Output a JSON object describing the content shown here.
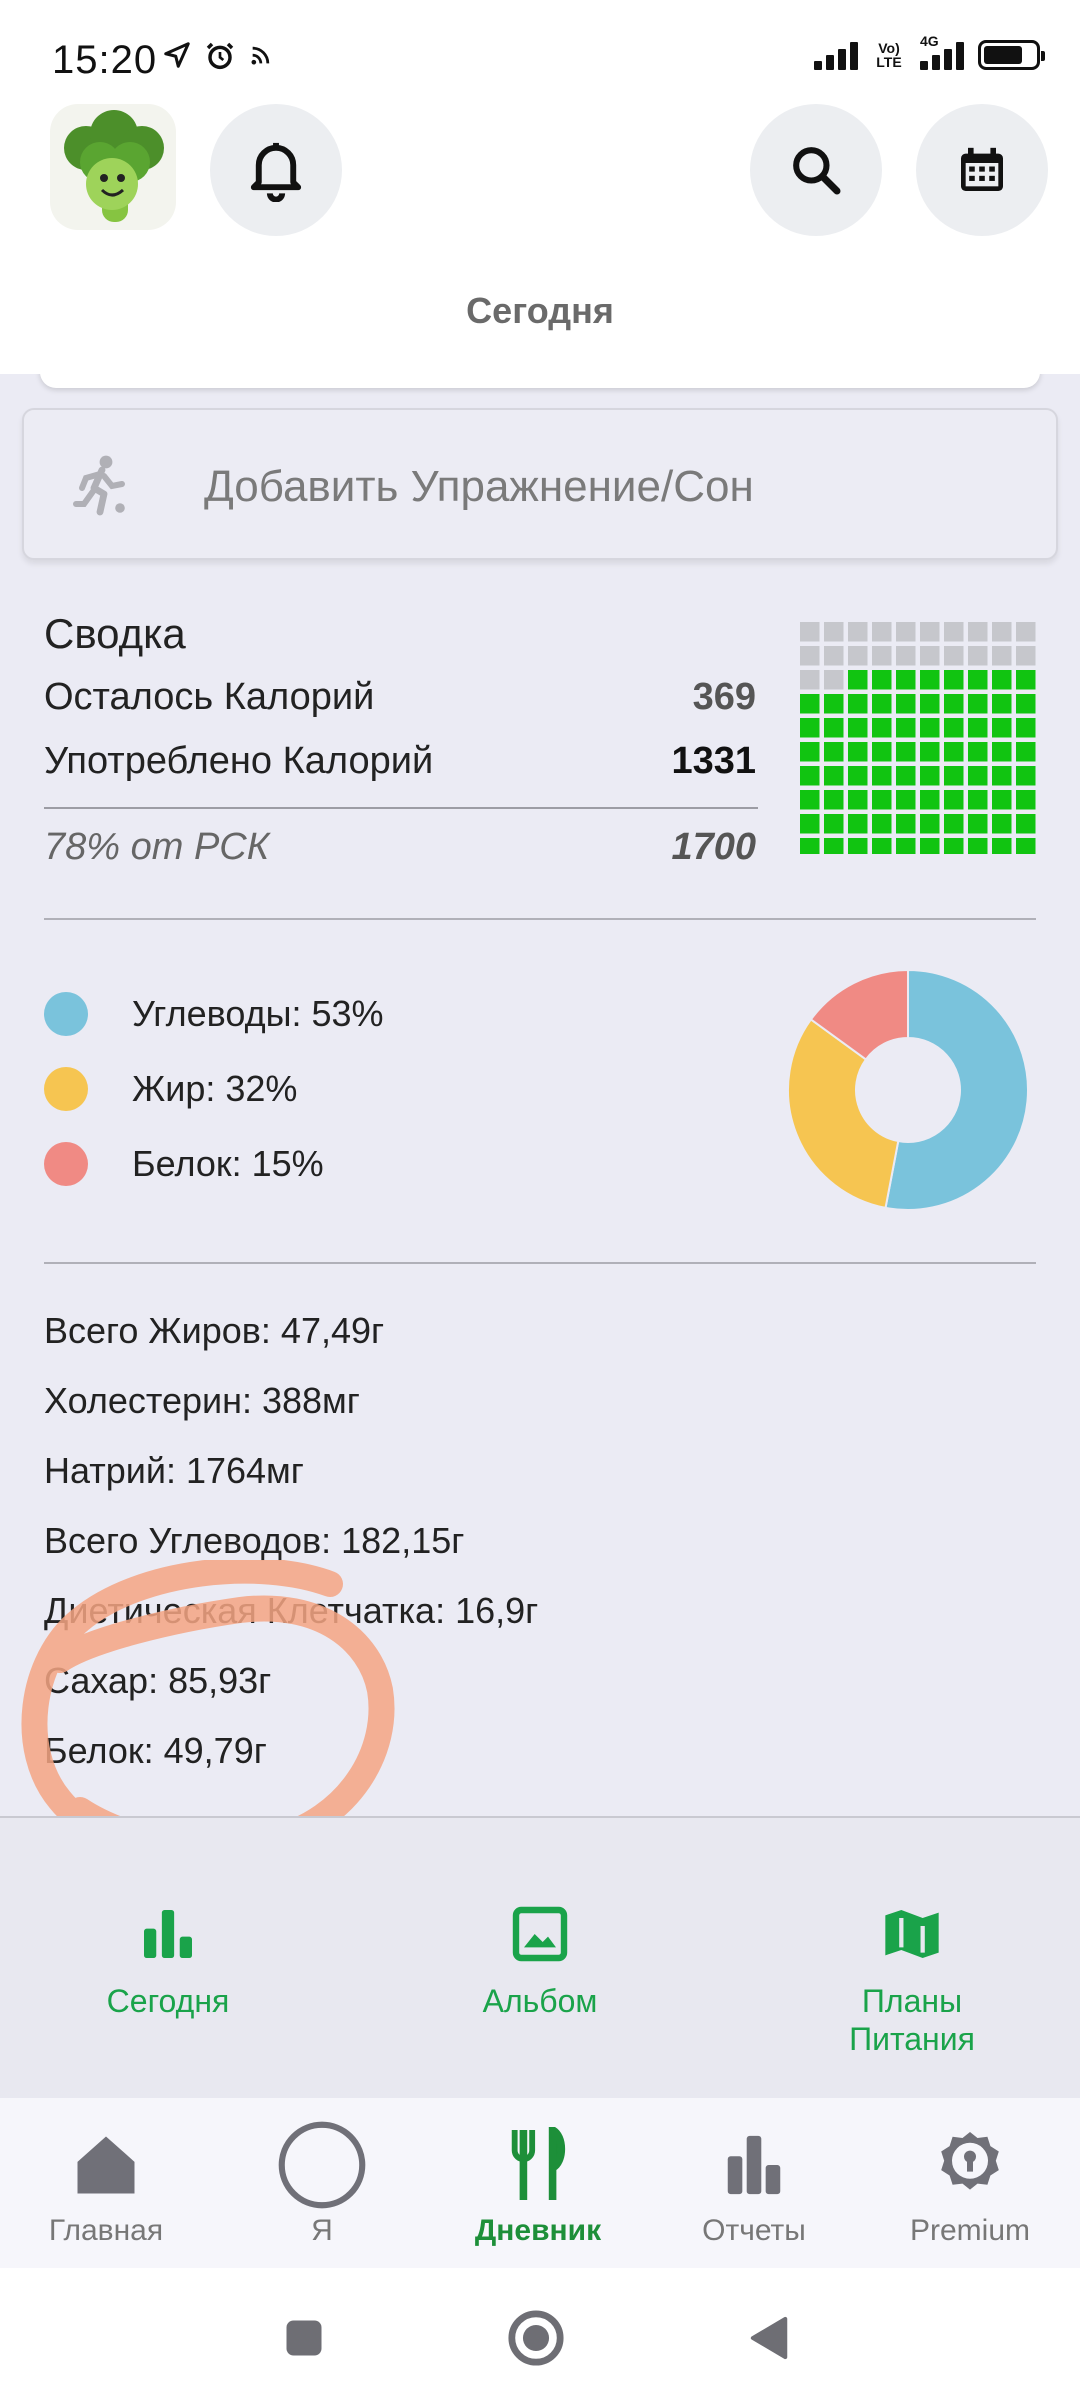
{
  "status": {
    "time": "15:20",
    "volte_label": "Vo) LTE",
    "net_label": "4G"
  },
  "header": {
    "title": "Сегодня"
  },
  "exercise": {
    "label": "Добавить Упражнение/Сон"
  },
  "summary": {
    "title": "Сводка",
    "remaining_label": "Осталось Калорий",
    "remaining_value": "369",
    "consumed_label": "Употреблено Калорий",
    "consumed_value": "1331",
    "percent_label": "78% от РСК",
    "target_value": "1700",
    "grid_filled_fraction": 0.78
  },
  "macros": {
    "items": [
      {
        "label": "Углеводы: 53%",
        "percent": 53,
        "color": "#7ac3dc"
      },
      {
        "label": "Жир: 32%",
        "percent": 32,
        "color": "#f6c551"
      },
      {
        "label": "Белок: 15%",
        "percent": 15,
        "color": "#f08a84"
      }
    ]
  },
  "nutrients": [
    "Всего Жиров: 47,49г",
    "Холестерин: 388мг",
    "Натрий: 1764мг",
    "Всего Углеводов: 182,15г",
    "Диетическая Клетчатка: 16,9г",
    "Сахар: 85,93г",
    "Белок: 49,79г"
  ],
  "tabs": {
    "today": "Сегодня",
    "album": "Альбом",
    "plans_line1": "Планы",
    "plans_line2": "Питания"
  },
  "nav": {
    "home": "Главная",
    "me": "Я",
    "diary": "Дневник",
    "reports": "Отчеты",
    "premium": "Premium"
  },
  "colors": {
    "accent_green": "#1aa34a",
    "grid_green": "#11c411",
    "grid_gray": "#c6c7cc"
  }
}
